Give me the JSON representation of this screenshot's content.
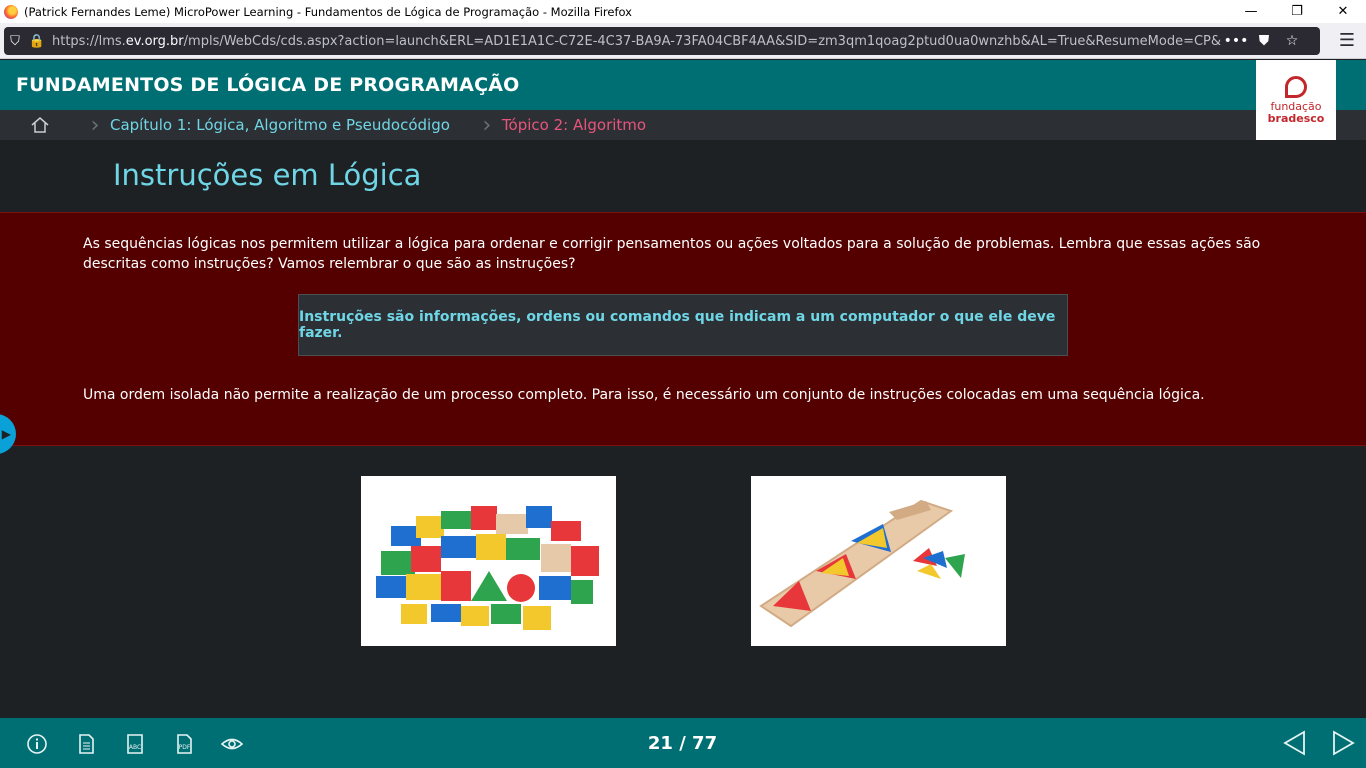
{
  "window": {
    "title": "(Patrick Fernandes Leme) MicroPower Learning - Fundamentos de Lógica de Programação - Mozilla Firefox",
    "minimize": "—",
    "restore": "❐",
    "close": "✕"
  },
  "browser": {
    "url_prefix": "https://lms.",
    "url_domain": "ev.org.br",
    "url_rest": "/mpls/WebCds/cds.aspx?action=launch&ERL=AD1E1A1C-C72E-4C37-BA9A-73FA04CBF4AA&SID=zm3qm1qoag2ptud0ua0wnzhb&AL=True&ResumeMode=CP&DCM=A",
    "more_label": "•••"
  },
  "header": {
    "course_title": "FUNDAMENTOS DE LÓGICA DE PROGRAMAÇÃO",
    "logo_line1": "fundação",
    "logo_line2": "bradesco"
  },
  "breadcrumb": {
    "chapter": "Capítulo 1: Lógica, Algoritmo e Pseudocódigo",
    "topic": "Tópico 2: Algoritmo"
  },
  "page": {
    "title": "Instruções em Lógica",
    "paragraph1": "As sequências lógicas nos permitem utilizar a lógica para ordenar e corrigir pensamentos ou ações voltados para a solução de problemas. Lembra que essas ações são descritas como instruções? Vamos relembrar o que são as instruções?",
    "highlight": "Instruções são informações, ordens ou comandos que indicam a um computador o que ele deve fazer.",
    "paragraph2": "Uma ordem isolada não permite a realização de um processo completo. Para isso, é necessário um conjunto de instruções colocadas em uma sequência lógica."
  },
  "footer": {
    "current_page": 21,
    "total_pages": 77,
    "counter": "21 / 77",
    "icons": [
      "info-icon",
      "document-icon",
      "glossary-icon",
      "pdf-icon",
      "eye-icon"
    ]
  },
  "colors": {
    "teal": "#006f73",
    "cyan": "#6fd6e6",
    "pink": "#e8547c",
    "maroon": "#550000",
    "dark": "#1e2124"
  }
}
